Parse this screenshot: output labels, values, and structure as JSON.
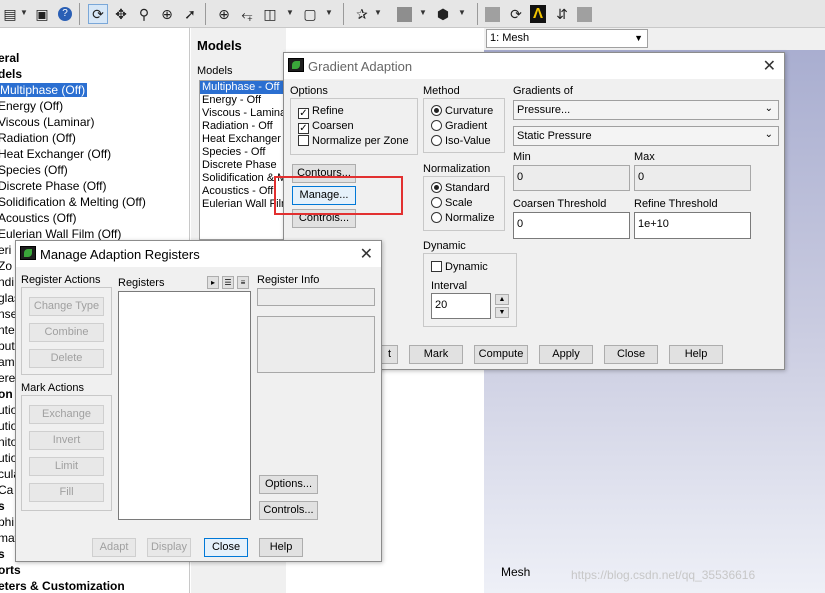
{
  "tree": {
    "items": [
      {
        "label": "eral",
        "bold": true
      },
      {
        "label": "dels",
        "bold": true
      },
      {
        "label": "Multiphase (Off)",
        "selected": true
      },
      {
        "label": "Energy (Off)"
      },
      {
        "label": "Viscous (Laminar)"
      },
      {
        "label": "Radiation (Off)"
      },
      {
        "label": "Heat Exchanger (Off)"
      },
      {
        "label": "Species (Off)"
      },
      {
        "label": "Discrete Phase (Off)"
      },
      {
        "label": "Solidification & Melting (Off)"
      },
      {
        "label": "Acoustics (Off)"
      },
      {
        "label": "Eulerian Wall Film (Off)"
      },
      {
        "label": "eri"
      },
      {
        "label": "Zo"
      },
      {
        "label": "ndi"
      },
      {
        "label": "glas"
      },
      {
        "label": "nse"
      },
      {
        "label": "nte"
      },
      {
        "label": "puts"
      },
      {
        "label": "am"
      },
      {
        "label": "ere"
      },
      {
        "label": "on",
        "bold": true
      },
      {
        "label": "utio"
      },
      {
        "label": "utio"
      },
      {
        "label": "nito"
      },
      {
        "label": "utio"
      },
      {
        "label": "cula"
      },
      {
        "label": "Ca"
      },
      {
        "label": "s",
        "bold": true
      },
      {
        "label": "phi"
      },
      {
        "label": "mat"
      },
      {
        "label": "s",
        "bold": true
      },
      {
        "label": "orts",
        "bold": true
      },
      {
        "label": "eters & Customization",
        "bold": true
      }
    ]
  },
  "models_panel": {
    "heading": "Models",
    "sublabel": "Models",
    "items": [
      "Multiphase - Off",
      "Energy - Off",
      "Viscous - Laminar",
      "Radiation - Off",
      "Heat Exchanger",
      "Species - Off",
      "Discrete Phase",
      "Solidification & M",
      "Acoustics - Off",
      "Eulerian Wall Film"
    ]
  },
  "graphics": {
    "window_select": "1: Mesh",
    "viewport_label": "Mesh",
    "watermark": "https://blog.csdn.net/qq_35536616"
  },
  "gradient_dialog": {
    "title": "Gradient Adaption",
    "options": {
      "label": "Options",
      "refine": {
        "label": "Refine",
        "checked": true
      },
      "coarsen": {
        "label": "Coarsen",
        "checked": true
      },
      "normalize_per_zone": {
        "label": "Normalize per Zone",
        "checked": false
      }
    },
    "buttons": {
      "contours": "Contours...",
      "manage": "Manage...",
      "controls": "Controls...",
      "mark": "Mark",
      "compute": "Compute",
      "apply": "Apply",
      "close": "Close",
      "help": "Help",
      "adapt_partial": "t"
    },
    "method": {
      "label": "Method",
      "options": [
        "Curvature",
        "Gradient",
        "Iso-Value"
      ],
      "selected": "Curvature"
    },
    "normalization": {
      "label": "Normalization",
      "options": [
        "Standard",
        "Scale",
        "Normalize"
      ],
      "selected": "Standard"
    },
    "dynamic": {
      "label": "Dynamic",
      "checkbox": {
        "label": "Dynamic",
        "checked": false
      },
      "interval_label": "Interval",
      "interval_value": "20"
    },
    "gradients_of": {
      "label": "Gradients of",
      "category": "Pressure...",
      "field": "Static Pressure"
    },
    "min": {
      "label": "Min",
      "value": "0"
    },
    "max": {
      "label": "Max",
      "value": "0"
    },
    "coarsen_threshold": {
      "label": "Coarsen Threshold",
      "value": "0"
    },
    "refine_threshold": {
      "label": "Refine Threshold",
      "value": "1e+10"
    }
  },
  "manage_dialog": {
    "title": "Manage Adaption Registers",
    "register_actions": {
      "label": "Register Actions",
      "change_type": "Change Type",
      "combine": "Combine",
      "delete": "Delete"
    },
    "mark_actions": {
      "label": "Mark Actions",
      "exchange": "Exchange",
      "invert": "Invert",
      "limit": "Limit",
      "fill": "Fill"
    },
    "registers_label": "Registers",
    "register_info_label": "Register Info",
    "buttons": {
      "options": "Options...",
      "controls": "Controls...",
      "adapt": "Adapt",
      "display": "Display",
      "close": "Close",
      "help": "Help"
    }
  }
}
